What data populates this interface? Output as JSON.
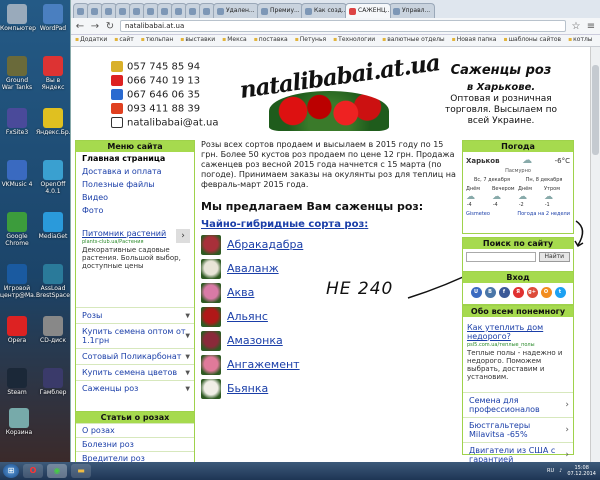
{
  "desktop": {
    "icons": [
      {
        "label": "Компьютер",
        "color": "#9ab"
      },
      {
        "label": "WordPad",
        "color": "#4a7fc0"
      },
      {
        "label": "Ground War Tanks",
        "color": "#6a6a3a"
      },
      {
        "label": "Вы в Яндекс",
        "color": "#d33"
      },
      {
        "label": "FxSite3",
        "color": "#4a4a9a"
      },
      {
        "label": "Яндекс.Бр...",
        "color": "#e0c020"
      },
      {
        "label": "VKMusic 4",
        "color": "#3a6ac0"
      },
      {
        "label": "OpenOff 4.0.1",
        "color": "#3aa0d0"
      },
      {
        "label": "Google Chrome",
        "color": "#3c9c3c"
      },
      {
        "label": "MediaGet",
        "color": "#2a9adb"
      },
      {
        "label": "Игровой центр@Ma...",
        "color": "#1a5aa0"
      },
      {
        "label": "AssLoad BrestSpace...",
        "color": "#2a7a9a"
      },
      {
        "label": "Opera",
        "color": "#d22"
      },
      {
        "label": "CD-диск",
        "color": "#888"
      },
      {
        "label": "Steam",
        "color": "#1b2838"
      },
      {
        "label": "Гамблер",
        "color": "#3a3a6a"
      },
      {
        "label": "Корзина",
        "color": "#7aa"
      }
    ]
  },
  "browser": {
    "tabs": [
      "",
      "",
      "",
      "",
      "",
      "",
      "",
      "",
      "",
      "",
      "Удален...",
      "Премиу...",
      "Как созд...",
      "САЖЕНЦ...",
      "Управл..."
    ],
    "url": "natalibabai.at.ua",
    "bookmarks": [
      "Додатки",
      "сайт",
      "тюльпан",
      "выставки",
      "Мекса",
      "поставка",
      "Петунья",
      "Технологии",
      "валютные отделы",
      "Новая папка",
      "шаблоны сайтов",
      "котлы"
    ]
  },
  "header": {
    "phones": [
      {
        "text": "057 745 85 94",
        "color": "#d9b02a"
      },
      {
        "text": "066 740 19 13",
        "color": "#d22"
      },
      {
        "text": "067 646 06 35",
        "color": "#2a6ad0"
      },
      {
        "text": "093 411 88 39",
        "color": "#e04020"
      },
      {
        "text": "natalibabai@at.ua",
        "color": "#fff"
      }
    ],
    "logo": "natalibabai.at.ua",
    "slogan_title": "Саженцы роз",
    "slogan_city": "в Харькове.",
    "slogan_text": "Оптовая и розничная торговля. Высылаем по всей Украине."
  },
  "site_menu": {
    "title": "Меню сайта",
    "items": [
      "Главная страница",
      "Доставка и оплата",
      "Полезные файлы",
      "Видео",
      "Фото"
    ]
  },
  "ad_left": {
    "title": "Питомник растений",
    "url": "plants-club.ua/Растения",
    "desc": "Декоративные садовые растения. Большой выбор, доступные цены"
  },
  "categories": [
    "Розы",
    "Купить семена оптом от 1.1грн",
    "Сотовый Поликарбонат",
    "Купить семена цветов",
    "Саженцы роз"
  ],
  "about_roses": {
    "title": "Статьи о розах",
    "items": [
      "О розах",
      "Болезни роз",
      "Вредители роз"
    ]
  },
  "main": {
    "intro": "Розы всех сортов продаем и высылаем в 2015 году по 15 грн. Более 50 кустов роз продаем по цене 12 грн. Продажа саженцев роз весной 2015 года начнется с 15 марта (по погоде). Принимаем заказы на окулянты роз для теплиц на февраль-март 2015 года.",
    "heading": "Мы предлагаем Вам саженцы роз:",
    "subheading": "Чайно-гибридные сорта роз",
    "subheading_suffix": ":",
    "roses": [
      {
        "name": "Абракадабра",
        "color": "#a8303a"
      },
      {
        "name": "Аваланж",
        "color": "#e8e4d8"
      },
      {
        "name": "Аква",
        "color": "#d97aa6"
      },
      {
        "name": "Альянс",
        "color": "#b01818"
      },
      {
        "name": "Амазонка",
        "color": "#8a2a3a"
      },
      {
        "name": "Ангажемент",
        "color": "#e07a9a"
      },
      {
        "name": "Бьянка",
        "color": "#f0eee6"
      }
    ],
    "handwritten": "НЕ 240"
  },
  "weather": {
    "title": "Погода",
    "city": "Харьков",
    "temp": "-6°С",
    "condition": "Пасмурно",
    "days": [
      {
        "name": "Днём",
        "temp": "-4"
      },
      {
        "name": "Вечером",
        "temp": "-4"
      },
      {
        "name": "Днём",
        "temp": "-2"
      },
      {
        "name": "Утром",
        "temp": "-1"
      }
    ],
    "day_labels": [
      "Вс, 7 декабря",
      "Пн, 8 декабря"
    ],
    "footer_left": "Gismeteo",
    "footer_right": "Погода на 2 недели"
  },
  "search": {
    "title": "Поиск по сайту",
    "placeholder": "",
    "button": "Найти"
  },
  "login": {
    "title": "Вход",
    "socials": [
      {
        "label": "U",
        "color": "#3a6ac0"
      },
      {
        "label": "B",
        "color": "#4a76a8"
      },
      {
        "label": "f",
        "color": "#3b5998"
      },
      {
        "label": "Я",
        "color": "#e03030"
      },
      {
        "label": "g+",
        "color": "#dd4b39"
      },
      {
        "label": "O",
        "color": "#f28c1e"
      },
      {
        "label": "t",
        "color": "#1da1f2"
      }
    ]
  },
  "ad_right": {
    "title_box": "Обо всем понемногу",
    "title": "Как утеплить дом недорого?",
    "url": "psl5.com.ua/теплые_полы",
    "desc": "Теплые полы - надежно и недорого. Поможем выбрать, доставим и установим."
  },
  "right_links": [
    "Семена для профессионалов",
    "Бюстгальтеры Milavitsa -65%",
    "Двигатели из США с гарантией"
  ],
  "taskbar": {
    "time": "15:08",
    "date": "07.12.2014",
    "lang": "RU"
  }
}
